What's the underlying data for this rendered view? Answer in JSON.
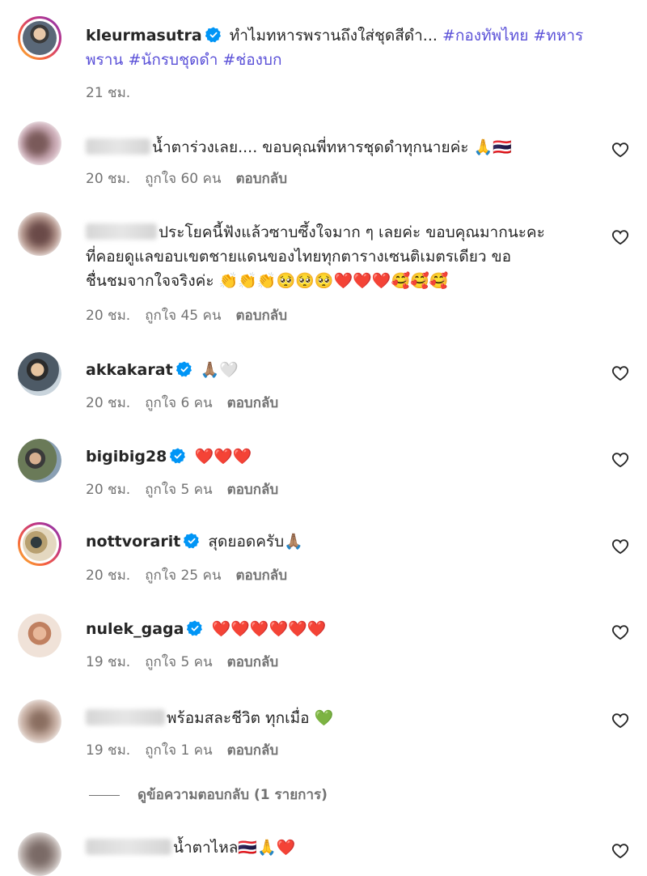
{
  "post": {
    "username": "kleurmasutra",
    "caption": "ทำไมทหารพรานถึงใส่ชุดสีดำ...",
    "hashtags": [
      "#กองทัพไทย",
      "#ทหาร",
      "พราน",
      "#นักรบชุดดำ",
      "#ช่องบก"
    ],
    "time": "21 ชม."
  },
  "comments": [
    {
      "user": "",
      "text": "น้ำตาร่วงเลย.... ขอบคุณพี่ทหารชุดดำทุกนายค่ะ 🙏🇹🇭",
      "time": "20 ชม.",
      "likes": "ถูกใจ 60 คน",
      "reply": "ตอบกลับ"
    },
    {
      "user": "",
      "text_line1": "ประโยคนี้ฟังแล้วซาบซึ้งใจมาก ๆ เลยค่ะ ขอบคุณมากนะคะ",
      "text_line2": "ที่คอยดูแลขอบเขตชายแดนของไทยทุกตารางเซนติเมตรเดียว ขอ",
      "text_line3": "ชื่นชมจากใจจริงค่ะ 👏👏👏🥺🥺🥺❤️❤️❤️🥰🥰🥰",
      "time": "20 ชม.",
      "likes": "ถูกใจ 45 คน",
      "reply": "ตอบกลับ"
    },
    {
      "user": "akkakarat",
      "text": "🙏🏽🤍",
      "time": "20 ชม.",
      "likes": "ถูกใจ 6 คน",
      "reply": "ตอบกลับ"
    },
    {
      "user": "bigibig28",
      "text": "❤️❤️❤️",
      "time": "20 ชม.",
      "likes": "ถูกใจ 5 คน",
      "reply": "ตอบกลับ"
    },
    {
      "user": "nottvorarit",
      "text": "สุดยอดครับ🙏🏽",
      "time": "20 ชม.",
      "likes": "ถูกใจ 25 คน",
      "reply": "ตอบกลับ"
    },
    {
      "user": "nulek_gaga",
      "text": "❤️❤️❤️❤️❤️❤️",
      "time": "19 ชม.",
      "likes": "ถูกใจ 5 คน",
      "reply": "ตอบกลับ"
    },
    {
      "user": "",
      "text": "พร้อมสละชีวิต ทุกเมื่อ 💚",
      "time": "19 ชม.",
      "likes": "ถูกใจ 1 คน",
      "reply": "ตอบกลับ"
    },
    {
      "user": "",
      "text": "น้ำตาไหล🇹🇭🙏❤️",
      "time": "",
      "likes": "",
      "reply": ""
    }
  ],
  "view_replies": "ดูข้อความตอบกลับ (1 รายการ)",
  "icons": {
    "verified": "verified-badge-icon",
    "like": "heart-outline-icon"
  },
  "colors": {
    "verified": "#0095f6",
    "hashtag": "#5b51d8",
    "meta": "#737373"
  }
}
